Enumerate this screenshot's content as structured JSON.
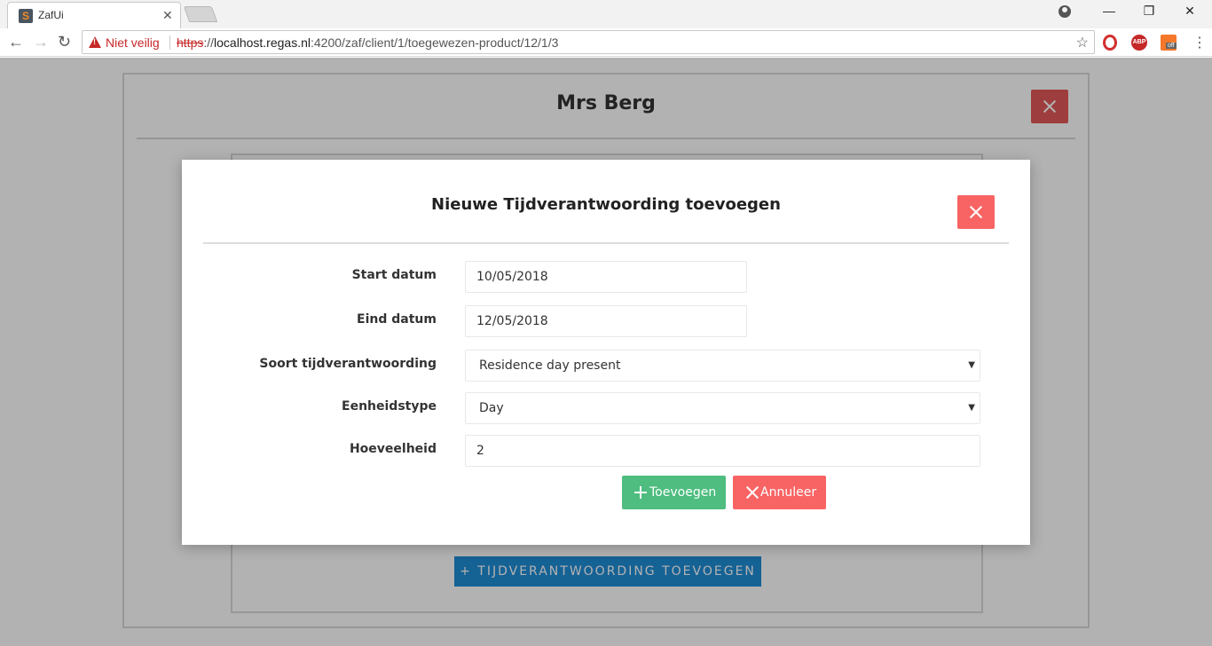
{
  "browser": {
    "tab_title": "ZafUi",
    "tab_favicon": "S",
    "security_label": "Niet veilig",
    "url_scheme": "https",
    "url_sep": "://",
    "url_host": "localhost.regas.nl",
    "url_path": ":4200/zaf/client/1/toegewezen-product/12/1/3",
    "icons": {
      "back": "arrow-left-icon",
      "forward": "arrow-right-icon",
      "reload": "reload-icon",
      "star": "star-icon",
      "warn": "warning-icon"
    },
    "window": {
      "minimize": "—",
      "restore": "❐",
      "close": "✕"
    },
    "ext_abp_label": "ABP",
    "ext_orange_label": "off"
  },
  "page": {
    "client_name": "Mrs Berg",
    "add_time_button": "+ TIJDVERANTWOORDING TOEVOEGEN"
  },
  "modal": {
    "title": "Nieuwe Tijdverantwoording toevoegen",
    "fields": {
      "start_label": "Start datum",
      "start_value": "10/05/2018",
      "end_label": "Eind datum",
      "end_value": "12/05/2018",
      "type_label": "Soort tijdverantwoording",
      "type_value": "Residence day present",
      "unit_label": "Eenheidstype",
      "unit_value": "Day",
      "qty_label": "Hoeveelheid",
      "qty_value": "2"
    },
    "add_label": "Toevoegen",
    "cancel_label": "Annuleer"
  },
  "colors": {
    "danger": "#f86464",
    "success": "#4ebd7f",
    "primary": "#1f8dd6"
  }
}
